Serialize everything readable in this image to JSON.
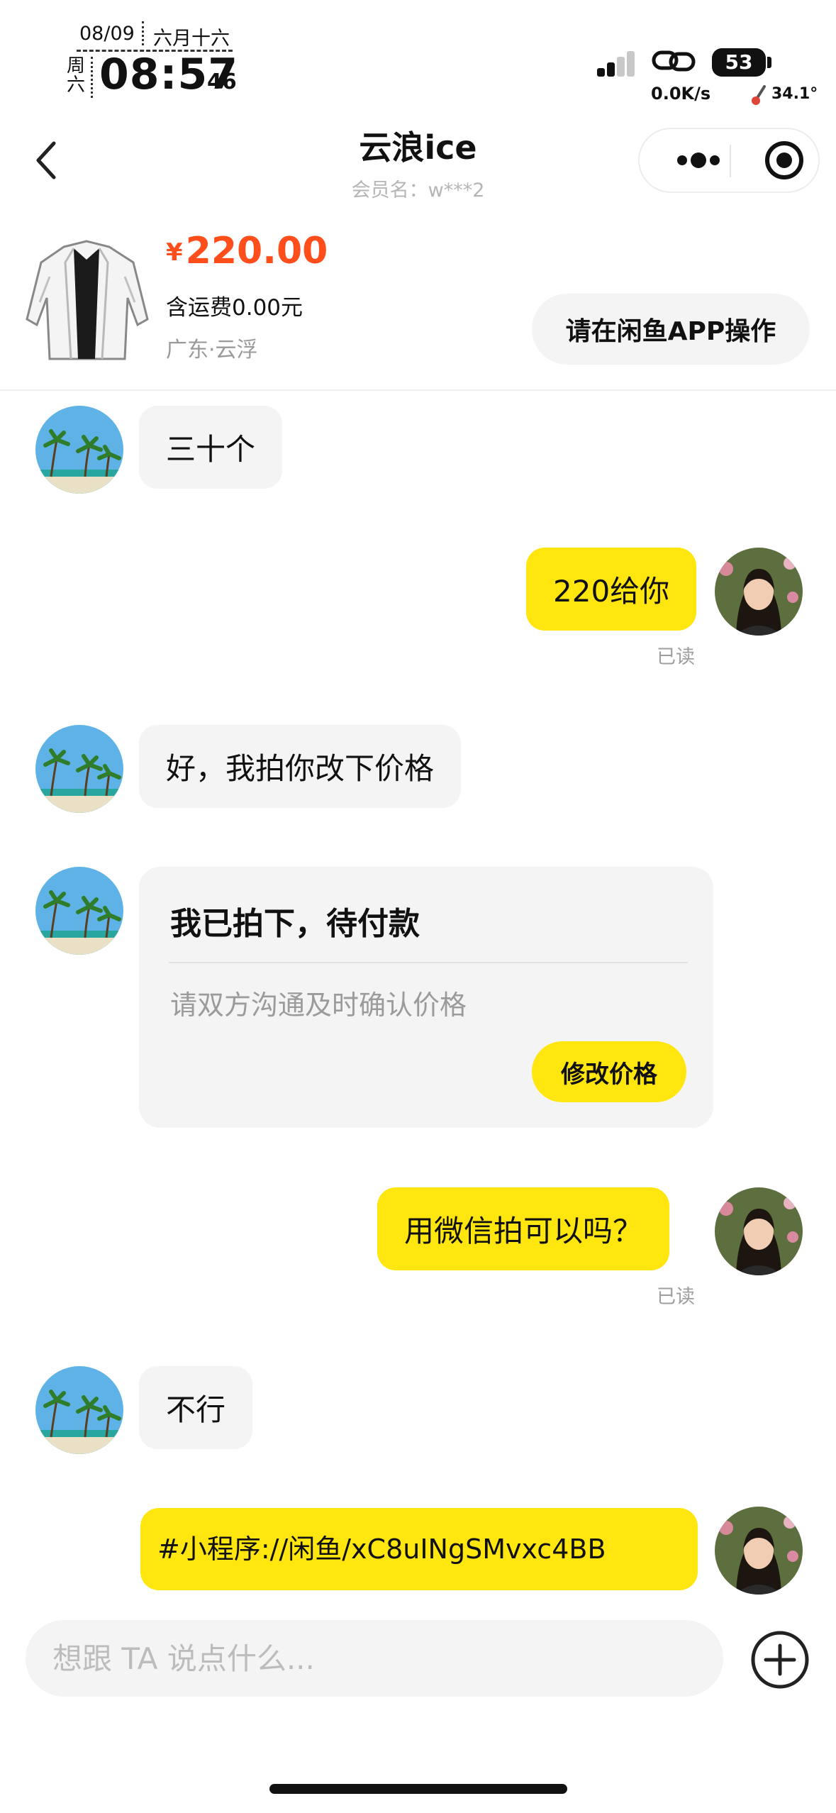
{
  "status_bar": {
    "date": "08/09",
    "lunar": "六月十六",
    "weekday": "周六",
    "time": "08:57",
    "seconds": "46",
    "battery": "53",
    "net_speed": "0.0K/s",
    "temperature": "34.1°"
  },
  "nav": {
    "title": "云浪ice",
    "subtitle": "会员名：w***2"
  },
  "product": {
    "currency": "¥",
    "price": "220.00",
    "shipping": "含运费0.00元",
    "location": "广东·云浮",
    "app_button": "请在闲鱼APP操作"
  },
  "messages": [
    {
      "side": "in",
      "text": "三十个"
    },
    {
      "side": "out",
      "text": "220给你",
      "status": "已读"
    },
    {
      "side": "in",
      "text": "好，我拍你改下价格"
    },
    {
      "side": "in-card",
      "title": "我已拍下，待付款",
      "subtitle": "请双方沟通及时确认价格",
      "button": "修改价格"
    },
    {
      "side": "out",
      "text": "用微信拍可以吗？",
      "status": "已读"
    },
    {
      "side": "in",
      "text": "不行"
    },
    {
      "side": "out",
      "text": "#小程序://闲鱼/xC8uINgSMvxc4BB"
    }
  ],
  "input": {
    "placeholder": "想跟 TA 说点什么..."
  },
  "icons": {
    "back": "chevron-left-icon",
    "more": "more-dots-icon",
    "close": "target-circle-icon",
    "plus": "plus-circle-icon",
    "link": "link-icon",
    "signal": "signal-icon",
    "thermometer": "thermometer-icon"
  },
  "colors": {
    "accent_yellow": "#ffe60f",
    "price_orange": "#ff4d1c",
    "incoming_bubble": "#f4f4f4"
  }
}
